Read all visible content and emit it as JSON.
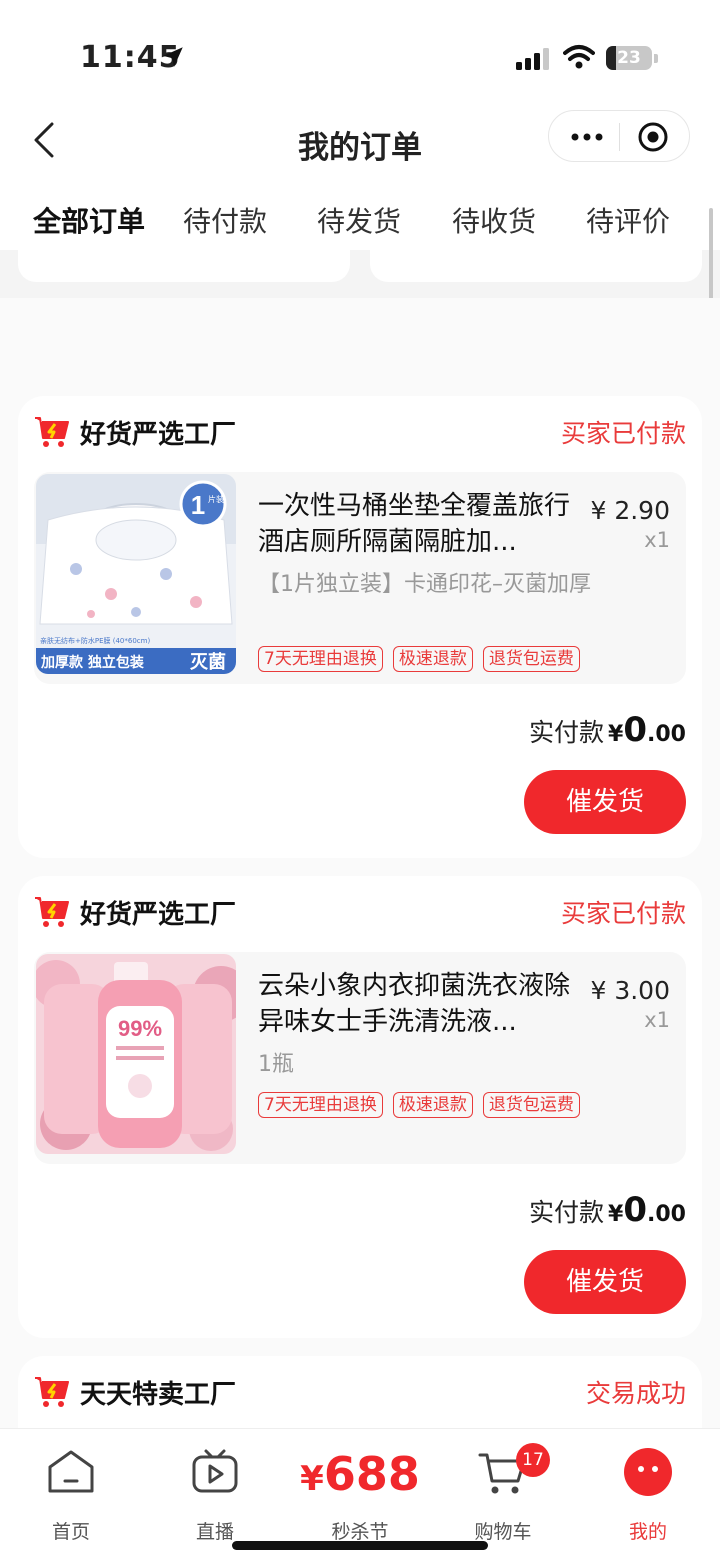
{
  "status_bar": {
    "time": "11:45",
    "battery": "23"
  },
  "header": {
    "title": "我的订单"
  },
  "tabs": [
    {
      "label": "全部订单",
      "active": true
    },
    {
      "label": "待付款"
    },
    {
      "label": "待发货"
    },
    {
      "label": "待收货"
    },
    {
      "label": "待评价"
    }
  ],
  "orders": [
    {
      "shop": "好货严选工厂",
      "status": "买家已付款",
      "product": {
        "title": "一次性马桶坐垫全覆盖旅行酒店厕所隔菌隔脏加...",
        "price": "¥ 2.90",
        "qty": "x1",
        "spec": "【1片独立装】卡通印花–灭菌加厚",
        "tags": [
          "7天无理由退换",
          "极速退款",
          "退货包运费"
        ],
        "image_text": {
          "badge": "1",
          "badge_sub": "片装",
          "band_left": "加厚款 独立包装",
          "band_right": "灭菌",
          "fine_print": "亲肤无纺布+防水PE膜 (40*60cm)"
        }
      },
      "pay_label": "实付款",
      "pay_yen": "¥",
      "pay_int": "0",
      "pay_dec": ".00",
      "button": "催发货"
    },
    {
      "shop": "好货严选工厂",
      "status": "买家已付款",
      "product": {
        "title": "云朵小象内衣抑菌洗衣液除异味女士手洗清洗液...",
        "price": "¥ 3.00",
        "qty": "x1",
        "spec": "1瓶",
        "tags": [
          "7天无理由退换",
          "极速退款",
          "退货包运费"
        ],
        "image_text": {
          "label": "99%"
        }
      },
      "pay_label": "实付款",
      "pay_yen": "¥",
      "pay_int": "0",
      "pay_dec": ".00",
      "button": "催发货"
    },
    {
      "shop": "天天特卖工厂",
      "status": "交易成功"
    }
  ],
  "tab_bar": {
    "home": "首页",
    "live": "直播",
    "promo_yen": "¥",
    "promo_num": "688",
    "promo_label": "秒杀节",
    "cart": "购物车",
    "cart_badge": "17",
    "me": "我的"
  },
  "colors": {
    "accent": "#f0282c",
    "status_red": "#e93b3b"
  }
}
